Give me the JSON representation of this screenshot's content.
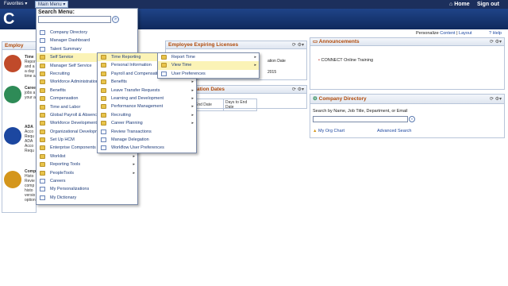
{
  "topbar": {
    "favorites": "Favorites",
    "main_menu": "Main Menu",
    "home": "Home",
    "sign_out": "Sign out"
  },
  "banner": {
    "logo_text": "C"
  },
  "personalize": {
    "prefix": "Personalize",
    "content": "Content",
    "sep": "|",
    "layout": "Layout",
    "help": "Help"
  },
  "search": {
    "label": "Search Menu:",
    "placeholder": ""
  },
  "main_menu_items": [
    {
      "label": "Company Directory",
      "icon": "page"
    },
    {
      "label": "Manager Dashboard",
      "icon": "page"
    },
    {
      "label": "Talent Summary",
      "icon": "page"
    },
    {
      "label": "Self Service",
      "icon": "folder",
      "arrow": true,
      "highlight": true
    },
    {
      "label": "Manager Self Service",
      "icon": "folder",
      "arrow": true
    },
    {
      "label": "Recruiting",
      "icon": "folder",
      "arrow": true
    },
    {
      "label": "Workforce Administration",
      "icon": "folder",
      "arrow": true
    },
    {
      "label": "Benefits",
      "icon": "folder",
      "arrow": true
    },
    {
      "label": "Compensation",
      "icon": "folder",
      "arrow": true
    },
    {
      "label": "Time and Labor",
      "icon": "folder",
      "arrow": true
    },
    {
      "label": "Global Payroll & Absence",
      "icon": "folder",
      "arrow": true
    },
    {
      "label": "Workforce Development",
      "icon": "folder",
      "arrow": true
    },
    {
      "label": "Organizational Development",
      "icon": "folder",
      "arrow": true
    },
    {
      "label": "Set Up HCM",
      "icon": "folder",
      "arrow": true
    },
    {
      "label": "Enterprise Components",
      "icon": "folder",
      "arrow": true
    },
    {
      "label": "Worklist",
      "icon": "folder",
      "arrow": true
    },
    {
      "label": "Reporting Tools",
      "icon": "folder",
      "arrow": true
    },
    {
      "label": "PeopleTools",
      "icon": "folder",
      "arrow": true
    },
    {
      "label": "Careers",
      "icon": "page"
    },
    {
      "label": "My Personalizations",
      "icon": "page"
    },
    {
      "label": "My Dictionary",
      "icon": "page"
    }
  ],
  "self_service_items": [
    {
      "label": "Time Reporting",
      "icon": "folder",
      "arrow": true,
      "highlight": true
    },
    {
      "label": "Personal Information",
      "icon": "folder",
      "arrow": true
    },
    {
      "label": "Payroll and Compensation",
      "icon": "folder",
      "arrow": true
    },
    {
      "label": "Benefits",
      "icon": "folder",
      "arrow": true
    },
    {
      "label": "Leave Transfer Requests",
      "icon": "folder",
      "arrow": true
    },
    {
      "label": "Learning and Development",
      "icon": "folder",
      "arrow": true
    },
    {
      "label": "Performance Management",
      "icon": "folder",
      "arrow": true
    },
    {
      "label": "Recruiting",
      "icon": "folder",
      "arrow": true
    },
    {
      "label": "Career Planning",
      "icon": "folder",
      "arrow": true
    },
    {
      "label": "Review Transactions",
      "icon": "page"
    },
    {
      "label": "Manage Delegation",
      "icon": "page"
    },
    {
      "label": "Workflow User Preferences",
      "icon": "page"
    }
  ],
  "time_reporting_items": [
    {
      "label": "Report Time",
      "icon": "folder",
      "arrow": true
    },
    {
      "label": "View Time",
      "icon": "folder",
      "arrow": true,
      "highlight": true
    },
    {
      "label": "User Preferences",
      "icon": "page"
    }
  ],
  "pagelets": {
    "employee_left": {
      "title": "Employ"
    },
    "expiring": {
      "title": "Employee Expiring Licenses",
      "col": "ation Date",
      "val": "2015"
    },
    "expiration": {
      "title": "ation Dates",
      "cols": [
        "End Date",
        "Days to End Date"
      ]
    },
    "announcements": {
      "title": "Announcements",
      "item": "CONNECT Online Training"
    },
    "directory": {
      "title": "Company Directory",
      "search_label": "Search by Name, Job Title, Department, or Email",
      "org_chart": "My Org Chart",
      "advanced": "Advanced Search"
    }
  },
  "left_tiles": [
    {
      "label": "Time",
      "lines": [
        "Repor",
        "and a",
        "a day",
        "time a"
      ]
    },
    {
      "label": "Caree",
      "lines": [
        "jobs a",
        "your a"
      ]
    },
    {
      "label": "ADA",
      "lines": [
        "Acco",
        "Requ",
        "ADA",
        "Acco",
        "Requ"
      ]
    },
    {
      "label": "Comp",
      "lines": [
        "Histo",
        "Revie",
        "comp",
        "histo",
        "versio",
        "option"
      ]
    }
  ],
  "colors": {
    "topbar": "#1c2f5c",
    "banner": "#1f4488",
    "highlight": "#fbf3b6",
    "title": "#b04a0a"
  }
}
